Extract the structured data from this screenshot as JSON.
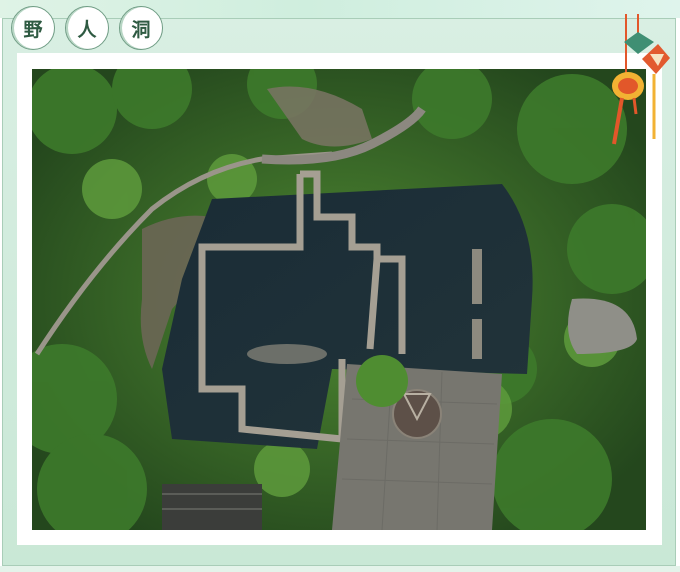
{
  "title": {
    "chars": [
      "野",
      "人",
      "洞"
    ]
  },
  "photo": {
    "subject": "aerial-view-cave-scenic-area"
  },
  "icons": {
    "ornament": "hanging-sachet-ornament-icon"
  },
  "colors": {
    "background_green": "#d9efe3",
    "title_text": "#2e5a42",
    "title_border": "#6f9c84",
    "ornament_red": "#e2572a",
    "ornament_gold": "#f2b233"
  }
}
